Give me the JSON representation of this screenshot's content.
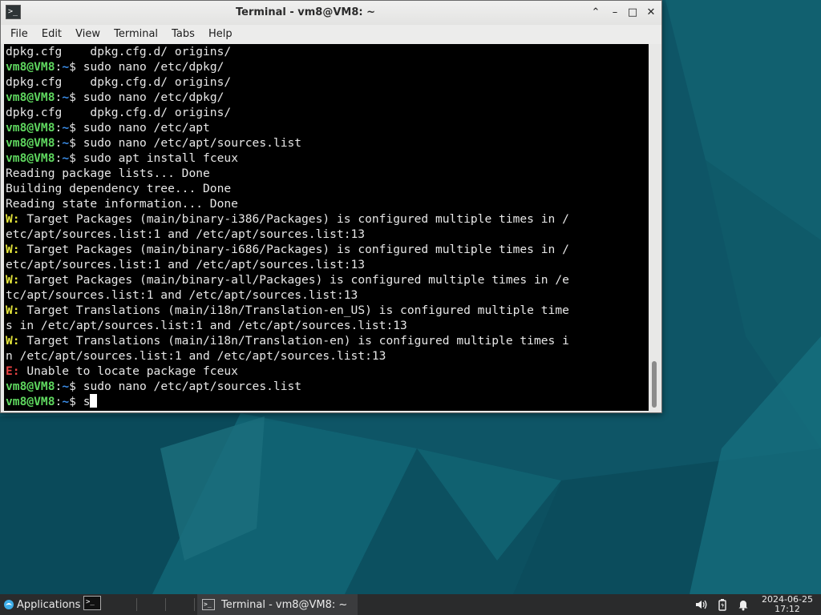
{
  "window": {
    "title": "Terminal - vm8@VM8: ~",
    "icon": "terminal-icon",
    "controls": {
      "collapse": "⌃",
      "minimize": "–",
      "maximize": "□",
      "close": "✕"
    }
  },
  "menu": [
    "File",
    "Edit",
    "View",
    "Terminal",
    "Tabs",
    "Help"
  ],
  "prompt": {
    "user": "vm8@VM8",
    "sep": ":",
    "path": "~",
    "dollar": "$ "
  },
  "terminal_lines": [
    {
      "type": "out",
      "text": "dpkg.cfg    dpkg.cfg.d/ origins/"
    },
    {
      "type": "cmd",
      "text": "sudo nano /etc/dpkg/"
    },
    {
      "type": "out",
      "text": "dpkg.cfg    dpkg.cfg.d/ origins/"
    },
    {
      "type": "cmd",
      "text": "sudo nano /etc/dpkg/"
    },
    {
      "type": "out",
      "text": "dpkg.cfg    dpkg.cfg.d/ origins/"
    },
    {
      "type": "cmd",
      "text": "sudo nano /etc/apt"
    },
    {
      "type": "cmd",
      "text": "sudo nano /etc/apt/sources.list"
    },
    {
      "type": "cmd",
      "text": "sudo apt install fceux"
    },
    {
      "type": "out",
      "text": "Reading package lists... Done"
    },
    {
      "type": "out",
      "text": "Building dependency tree... Done"
    },
    {
      "type": "out",
      "text": "Reading state information... Done"
    },
    {
      "type": "warn",
      "tag": "W:",
      "text": " Target Packages (main/binary-i386/Packages) is configured multiple times in /"
    },
    {
      "type": "out",
      "text": "etc/apt/sources.list:1 and /etc/apt/sources.list:13"
    },
    {
      "type": "warn",
      "tag": "W:",
      "text": " Target Packages (main/binary-i686/Packages) is configured multiple times in /"
    },
    {
      "type": "out",
      "text": "etc/apt/sources.list:1 and /etc/apt/sources.list:13"
    },
    {
      "type": "warn",
      "tag": "W:",
      "text": " Target Packages (main/binary-all/Packages) is configured multiple times in /e"
    },
    {
      "type": "out",
      "text": "tc/apt/sources.list:1 and /etc/apt/sources.list:13"
    },
    {
      "type": "warn",
      "tag": "W:",
      "text": " Target Translations (main/i18n/Translation-en_US) is configured multiple time"
    },
    {
      "type": "out",
      "text": "s in /etc/apt/sources.list:1 and /etc/apt/sources.list:13"
    },
    {
      "type": "warn",
      "tag": "W:",
      "text": " Target Translations (main/i18n/Translation-en) is configured multiple times i"
    },
    {
      "type": "out",
      "text": "n /etc/apt/sources.list:1 and /etc/apt/sources.list:13"
    },
    {
      "type": "err",
      "tag": "E:",
      "text": " Unable to locate package fceux"
    },
    {
      "type": "cmd",
      "text": "sudo nano /etc/apt/sources.list"
    },
    {
      "type": "cmd",
      "text": "s",
      "cursor": true
    }
  ],
  "taskbar": {
    "applications_label": "Applications",
    "task_label": "Terminal - vm8@VM8: ~",
    "tray": {
      "volume": "volume-icon",
      "battery": "battery-icon",
      "notifications": "bell-icon"
    },
    "clock_date": "2024-06-25",
    "clock_time": "17:12"
  },
  "colors": {
    "prompt_user": "#5fd75f",
    "prompt_path": "#3b8eea",
    "warning": "#e6e63a",
    "error": "#e84343",
    "terminal_bg": "#000000",
    "desktop": "#0d5a6c"
  }
}
